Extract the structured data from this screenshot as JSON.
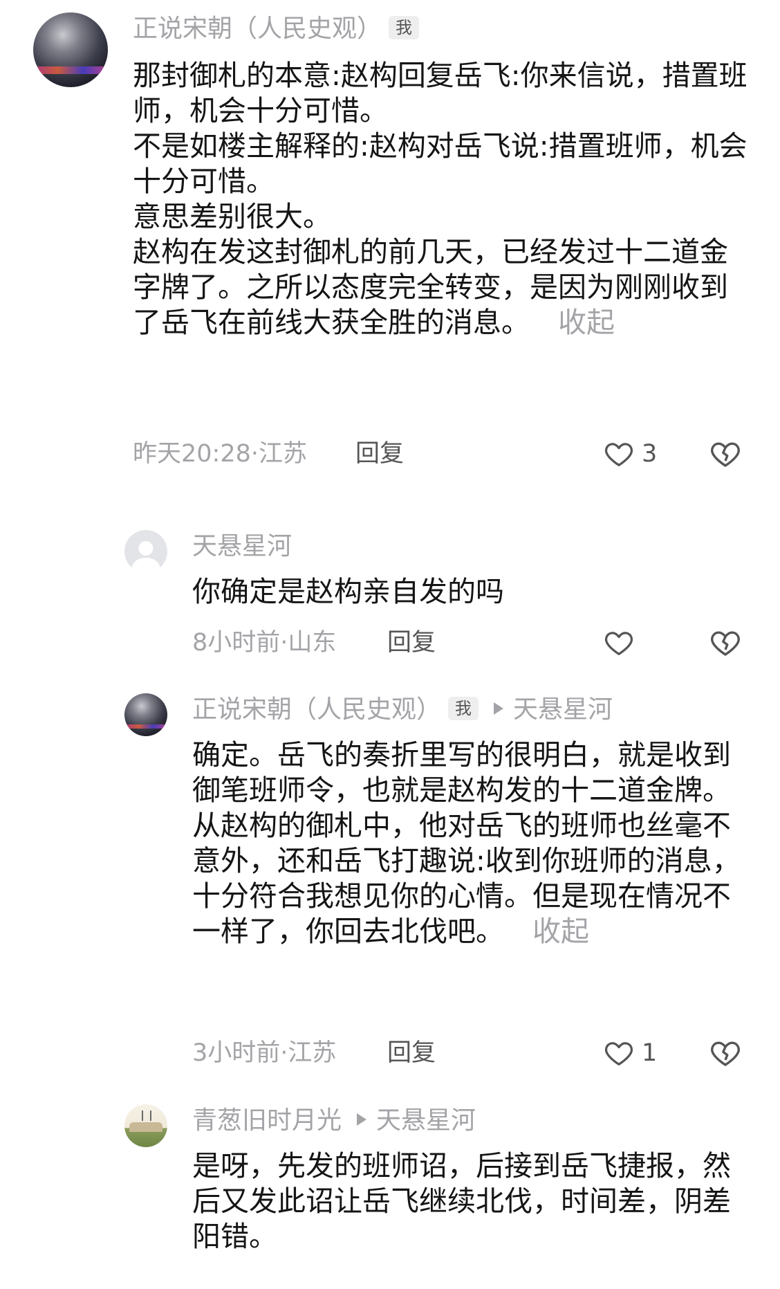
{
  "comments": [
    {
      "author": "正说宋朝（人民史观）",
      "badge": "我",
      "paragraphs": [
        "那封御札的本意:赵构回复岳飞:你来信说，措置班师，机会十分可惜。",
        "不是如楼主解释的:赵构对岳飞说:措置班师，机会十分可惜。",
        "意思差别很大。",
        "赵构在发这封御札的前几天，已经发过十二道金字牌了。之所以态度完全转变，是因为刚刚收到了岳飞在前线大获全胜的消息。"
      ],
      "collapse": "收起",
      "meta": "昨天20:28·江苏",
      "reply": "回复",
      "likes": "3",
      "avatar_icon": "night-city-avatar"
    },
    {
      "author": "天悬星河",
      "text": "你确定是赵构亲自发的吗",
      "meta": "8小时前·山东",
      "reply": "回复",
      "likes": "",
      "avatar_icon": "default-user-avatar"
    },
    {
      "author": "正说宋朝（人民史观）",
      "badge": "我",
      "reply_to": "天悬星河",
      "text": "确定。岳飞的奏折里写的很明白，就是收到御笔班师令，也就是赵构发的十二道金牌。从赵构的御札中，他对岳飞的班师也丝毫不意外，还和岳飞打趣说:收到你班师的消息，十分符合我想见你的心情。但是现在情况不一样了，你回去北伐吧。",
      "collapse": "收起",
      "meta": "3小时前·江苏",
      "reply": "回复",
      "likes": "1",
      "avatar_icon": "night-city-avatar"
    },
    {
      "author": "青葱旧时月光",
      "reply_to": "天悬星河",
      "text": "是呀，先发的班师诏，后接到岳飞捷报，然后又发此诏让岳飞继续北伐，时间差，阴差阳错。",
      "avatar_icon": "landscape-avatar"
    }
  ],
  "icons": {
    "like": "heart-outline-icon",
    "dislike": "broken-heart-icon",
    "reply_arrow": "triangle-right-icon"
  },
  "colors": {
    "text": "#151515",
    "muted": "#a4a4a8",
    "action": "#555555",
    "badge_bg": "#eeeeee"
  }
}
